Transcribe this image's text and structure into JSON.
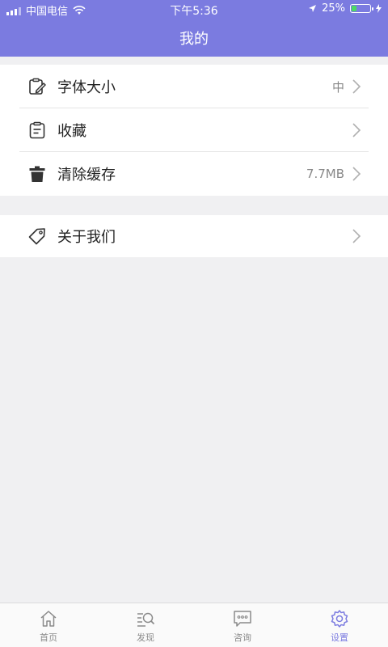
{
  "status_bar": {
    "carrier": "中国电信",
    "time": "下午5:36",
    "battery": "25%"
  },
  "header": {
    "title": "我的"
  },
  "settings": {
    "font_size": {
      "label": "字体大小",
      "value": "中",
      "icon": "edit-clipboard-icon"
    },
    "favorites": {
      "label": "收藏",
      "icon": "clipboard-icon"
    },
    "clear_cache": {
      "label": "清除缓存",
      "value": "7.7MB",
      "icon": "trash-icon"
    },
    "about": {
      "label": "关于我们",
      "icon": "tag-icon"
    }
  },
  "tabbar": {
    "home": {
      "label": "首页",
      "icon": "home-icon"
    },
    "discover": {
      "label": "发现",
      "icon": "search-list-icon"
    },
    "consult": {
      "label": "咨询",
      "icon": "chat-icon"
    },
    "settings": {
      "label": "设置",
      "icon": "gear-icon"
    }
  },
  "colors": {
    "accent": "#7b7be0",
    "background": "#f0f0f2",
    "battery_fill": "#4cd964"
  }
}
